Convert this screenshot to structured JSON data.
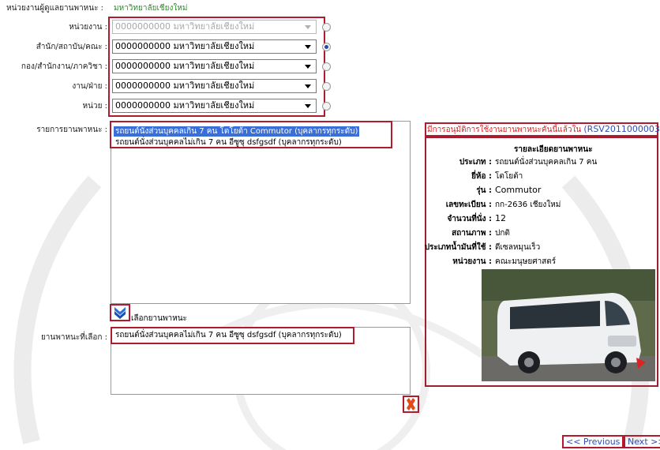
{
  "header": {
    "label": "หน่วยงานผู้ดูแลยานพาหนะ :",
    "value": "มหาวิทยาลัยเชียงใหม่"
  },
  "org_fields": [
    {
      "label": "หน่วยงาน :",
      "value": "0000000000 มหาวิทยาลัยเชียงใหม่",
      "disabled": true,
      "selected": false
    },
    {
      "label": "สำนัก/สถาบัน/คณะ :",
      "value": "0000000000 มหาวิทยาลัยเชียงใหม่",
      "disabled": false,
      "selected": true
    },
    {
      "label": "กอง/สำนักงาน/ภาควิชา :",
      "value": "0000000000 มหาวิทยาลัยเชียงใหม่",
      "disabled": false,
      "selected": false
    },
    {
      "label": "งาน/ฝ่าย :",
      "value": "0000000000 มหาวิทยาลัยเชียงใหม่",
      "disabled": false,
      "selected": false
    },
    {
      "label": "หน่วย :",
      "value": "0000000000 มหาวิทยาลัยเชียงใหม่",
      "disabled": false,
      "selected": false
    }
  ],
  "vehicle_list": {
    "label": "รายการยานพาหนะ :",
    "items": [
      "รถยนต์นั่งส่วนบุคคลเกิน 7 คน โตโยต้า Commutor (บุคลากรทุกระดับ)",
      "รถยนต์นั่งส่วนบุคคลไม่เกิน 7 คน อีซูซุ dsfgsdf (บุคลากรทุกระดับ)"
    ],
    "selected_index": 0
  },
  "select_action": {
    "label": "เลือกยานพาหนะ"
  },
  "chosen": {
    "label": "ยานพาหนะที่เลือก :",
    "value": "รถยนต์นั่งส่วนบุคคลไม่เกิน 7 คน อีซูซุ dsfgsdf (บุคลากรทุกระดับ)"
  },
  "alert": {
    "text": "มีการอนุมัติการใช้งานยานพาหนะคันนี้แล้วใน",
    "ref": "(RSV2011000003)"
  },
  "detail": {
    "title": "รายละเอียดยานพาหนะ",
    "rows": [
      {
        "key": "ประเภท :",
        "value": "รถยนต์นั่งส่วนบุคคลเกิน 7 คน"
      },
      {
        "key": "ยี่ห้อ :",
        "value": "โตโยต้า"
      },
      {
        "key": "รุ่น :",
        "value": "Commutor"
      },
      {
        "key": "เลขทะเบียน :",
        "value": "กก-2636 เชียงใหม่"
      },
      {
        "key": "จำนวนที่นั่ง :",
        "value": "12"
      },
      {
        "key": "สถานภาพ :",
        "value": "ปกติ"
      },
      {
        "key": "ประเภทน้ำมันที่ใช้ :",
        "value": "ดีเซลหมุนเร็ว"
      },
      {
        "key": "หน่วยงาน :",
        "value": "คณะมนุษยศาสตร์"
      }
    ]
  },
  "nav": {
    "previous": "<< Previous",
    "next": "Next >>"
  },
  "colors": {
    "accent_red": "#b01c2e",
    "link_blue": "#2d4fb4",
    "header_green": "#2e8b2e"
  }
}
